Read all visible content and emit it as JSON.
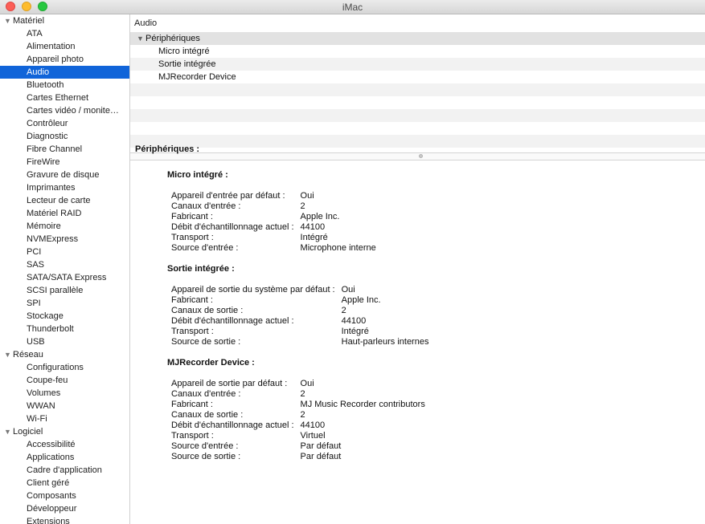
{
  "window": {
    "title": "iMac"
  },
  "sidebar": {
    "groups": [
      {
        "label": "Matériel",
        "items": [
          "ATA",
          "Alimentation",
          "Appareil photo",
          "Audio",
          "Bluetooth",
          "Cartes Ethernet",
          "Cartes vidéo / monite…",
          "Contrôleur",
          "Diagnostic",
          "Fibre Channel",
          "FireWire",
          "Gravure de disque",
          "Imprimantes",
          "Lecteur de carte",
          "Matériel RAID",
          "Mémoire",
          "NVMExpress",
          "PCI",
          "SAS",
          "SATA/SATA Express",
          "SCSI parallèle",
          "SPI",
          "Stockage",
          "Thunderbolt",
          "USB"
        ]
      },
      {
        "label": "Réseau",
        "items": [
          "Configurations",
          "Coupe-feu",
          "Volumes",
          "WWAN",
          "Wi-Fi"
        ]
      },
      {
        "label": "Logiciel",
        "items": [
          "Accessibilité",
          "Applications",
          "Cadre d'application",
          "Client géré",
          "Composants",
          "Développeur",
          "Extensions"
        ]
      }
    ],
    "selected": "Audio"
  },
  "main": {
    "section_title": "Audio",
    "tree": {
      "group": "Périphériques",
      "items": [
        "Micro intégré",
        "Sortie intégrée",
        "MJRecorder Device"
      ]
    },
    "detail": {
      "heading": "Périphériques :",
      "devices": [
        {
          "name": "Micro intégré :",
          "props": [
            [
              "Appareil d'entrée par défaut :",
              "Oui"
            ],
            [
              "Canaux d'entrée :",
              "2"
            ],
            [
              "Fabricant :",
              "Apple Inc."
            ],
            [
              "Débit d'échantillonnage actuel :",
              "44100"
            ],
            [
              "Transport :",
              "Intégré"
            ],
            [
              "Source d'entrée :",
              "Microphone interne"
            ]
          ]
        },
        {
          "name": "Sortie intégrée :",
          "props": [
            [
              "Appareil de sortie du système par défaut :",
              "Oui"
            ],
            [
              "Fabricant :",
              "Apple Inc."
            ],
            [
              "Canaux de sortie :",
              "2"
            ],
            [
              "Débit d'échantillonnage actuel :",
              "44100"
            ],
            [
              "Transport :",
              "Intégré"
            ],
            [
              "Source de sortie :",
              "Haut-parleurs internes"
            ]
          ]
        },
        {
          "name": "MJRecorder Device :",
          "props": [
            [
              "Appareil de sortie par défaut :",
              "Oui"
            ],
            [
              "Canaux d'entrée :",
              "2"
            ],
            [
              "Fabricant :",
              "MJ Music Recorder contributors"
            ],
            [
              "Canaux de sortie :",
              "2"
            ],
            [
              "Débit d'échantillonnage actuel :",
              "44100"
            ],
            [
              "Transport :",
              "Virtuel"
            ],
            [
              "Source d'entrée :",
              "Par défaut"
            ],
            [
              "Source de sortie :",
              "Par défaut"
            ]
          ]
        }
      ]
    }
  }
}
